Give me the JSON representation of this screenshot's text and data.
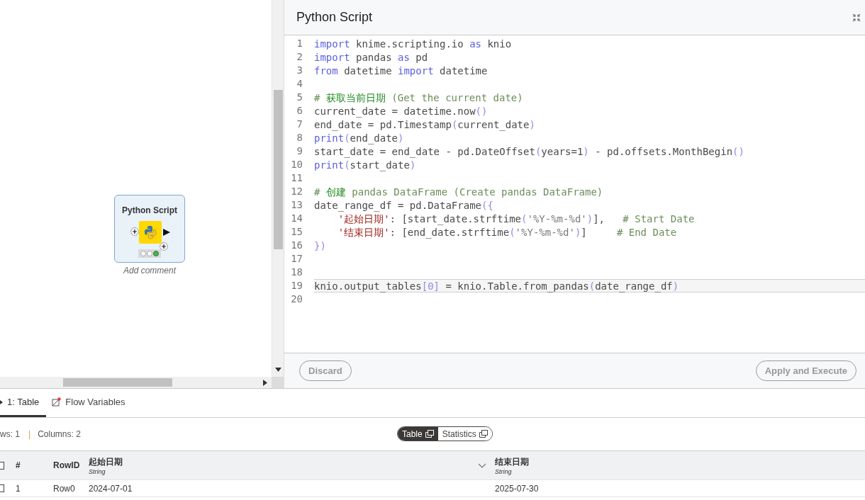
{
  "canvas": {
    "node": {
      "title": "Python Script",
      "comment": "Add comment",
      "lights": [
        {
          "on": false
        },
        {
          "on": false
        },
        {
          "on": true,
          "color": "#4caf50"
        }
      ]
    }
  },
  "editor": {
    "title": "Python Script",
    "lines": [
      {
        "number": "1",
        "active": false,
        "tokens": [
          {
            "kind": "keyword",
            "text": "import"
          },
          {
            "kind": "plain",
            "text": " knime.scripting.io "
          },
          {
            "kind": "keyword",
            "text": "as"
          },
          {
            "kind": "plain",
            "text": " knio"
          }
        ]
      },
      {
        "number": "2",
        "active": false,
        "tokens": [
          {
            "kind": "keyword",
            "text": "import"
          },
          {
            "kind": "plain",
            "text": " pandas "
          },
          {
            "kind": "keyword",
            "text": "as"
          },
          {
            "kind": "plain",
            "text": " pd"
          }
        ]
      },
      {
        "number": "3",
        "active": false,
        "tokens": [
          {
            "kind": "keyword",
            "text": "from"
          },
          {
            "kind": "plain",
            "text": " datetime "
          },
          {
            "kind": "keyword",
            "text": "import"
          },
          {
            "kind": "plain",
            "text": " datetime"
          }
        ]
      },
      {
        "number": "4"
      },
      {
        "number": "5",
        "active": false,
        "tokens": [
          {
            "kind": "comment",
            "text": "# "
          },
          {
            "kind": "comment_cjk",
            "text": "获取当前日期"
          },
          {
            "kind": "comment",
            "text": " (Get the current date)"
          }
        ]
      },
      {
        "number": "6",
        "active": false,
        "tokens": [
          {
            "kind": "plain",
            "text": "current_date = datetime.now"
          },
          {
            "kind": "bracket",
            "text": "()"
          }
        ]
      },
      {
        "number": "7",
        "active": false,
        "tokens": [
          {
            "kind": "plain",
            "text": "end_date = pd.Timestamp"
          },
          {
            "kind": "bracket",
            "text": "("
          },
          {
            "kind": "plain",
            "text": "current_date"
          },
          {
            "kind": "bracket",
            "text": ")"
          }
        ]
      },
      {
        "number": "8",
        "active": false,
        "tokens": [
          {
            "kind": "keyword",
            "text": "print"
          },
          {
            "kind": "bracket",
            "text": "("
          },
          {
            "kind": "plain",
            "text": "end_date"
          },
          {
            "kind": "bracket",
            "text": ")"
          }
        ]
      },
      {
        "number": "9",
        "active": false,
        "tokens": [
          {
            "kind": "plain",
            "text": "start_date = end_date - pd.DateOffset"
          },
          {
            "kind": "bracket",
            "text": "("
          },
          {
            "kind": "plain",
            "text": "years=1"
          },
          {
            "kind": "bracket",
            "text": ")"
          },
          {
            "kind": "plain",
            "text": " - pd.offsets.MonthBegin"
          },
          {
            "kind": "bracket",
            "text": "()"
          }
        ]
      },
      {
        "number": "10",
        "active": false,
        "tokens": [
          {
            "kind": "keyword",
            "text": "print"
          },
          {
            "kind": "bracket",
            "text": "("
          },
          {
            "kind": "plain",
            "text": "start_date"
          },
          {
            "kind": "bracket",
            "text": ")"
          }
        ]
      },
      {
        "number": "11"
      },
      {
        "number": "12",
        "active": false,
        "tokens": [
          {
            "kind": "comment",
            "text": "# "
          },
          {
            "kind": "comment_cjk",
            "text": "创建"
          },
          {
            "kind": "comment",
            "text": " pandas DataFrame (Create pandas DataFrame)"
          }
        ]
      },
      {
        "number": "13",
        "active": false,
        "tokens": [
          {
            "kind": "plain",
            "text": "date_range_df = pd.DataFrame"
          },
          {
            "kind": "bracket",
            "text": "({"
          }
        ]
      },
      {
        "number": "14",
        "active": false,
        "tokens": [
          {
            "kind": "string_cjk",
            "text": "    '起始日期'"
          },
          {
            "kind": "plain",
            "text": ": [start_date.strftime"
          },
          {
            "kind": "bracket",
            "text": "("
          },
          {
            "kind": "string",
            "text": "'%Y-%m-%d'"
          },
          {
            "kind": "bracket",
            "text": ")"
          },
          {
            "kind": "plain",
            "text": "],   "
          },
          {
            "kind": "comment",
            "text": "# Start Date"
          }
        ]
      },
      {
        "number": "15",
        "active": false,
        "tokens": [
          {
            "kind": "string_cjk",
            "text": "    '结束日期'"
          },
          {
            "kind": "plain",
            "text": ": [end_date.strftime"
          },
          {
            "kind": "bracket",
            "text": "("
          },
          {
            "kind": "string",
            "text": "'%Y-%m-%d'"
          },
          {
            "kind": "bracket",
            "text": ")"
          },
          {
            "kind": "plain",
            "text": "]     "
          },
          {
            "kind": "comment",
            "text": "# End Date"
          }
        ]
      },
      {
        "number": "16",
        "active": false,
        "tokens": [
          {
            "kind": "bracket",
            "text": "})"
          }
        ]
      },
      {
        "number": "17"
      },
      {
        "number": "18"
      },
      {
        "number": "19",
        "active": true,
        "tokens": [
          {
            "kind": "plain",
            "text": "knio.output_tables"
          },
          {
            "kind": "bracket",
            "text": "[0]"
          },
          {
            "kind": "plain",
            "text": " = knio.Table.from_pandas"
          },
          {
            "kind": "bracket",
            "text": "("
          },
          {
            "kind": "plain",
            "text": "date_range_df"
          },
          {
            "kind": "bracket",
            "text": ")"
          }
        ]
      },
      {
        "number": "20"
      }
    ]
  },
  "footer": {
    "buttons": [
      {
        "label": "Discard"
      },
      {
        "label": "Apply and Execute"
      }
    ]
  },
  "output": {
    "tabs": [
      {
        "kind": "port",
        "label": "1: Table",
        "selected": true
      },
      {
        "kind": "variables",
        "label": "Flow Variables",
        "selected": false
      }
    ],
    "summary": {
      "rows": "ws: 1",
      "separator": "|",
      "columns": "Columns: 2"
    },
    "view_toggle": [
      {
        "label": "Table",
        "selected": true
      },
      {
        "label": "Statistics",
        "selected": false
      }
    ],
    "table": {
      "select_all_checked": false,
      "columns": [
        {
          "label": "#"
        },
        {
          "label": "RowID"
        },
        {
          "label": "起始日期",
          "type": "String"
        },
        {
          "label": "结束日期",
          "type": "String"
        }
      ],
      "rows": [
        {
          "checked": false,
          "cells": [
            "1",
            "Row0",
            "2024-07-01",
            "2025-07-30"
          ]
        }
      ]
    }
  }
}
